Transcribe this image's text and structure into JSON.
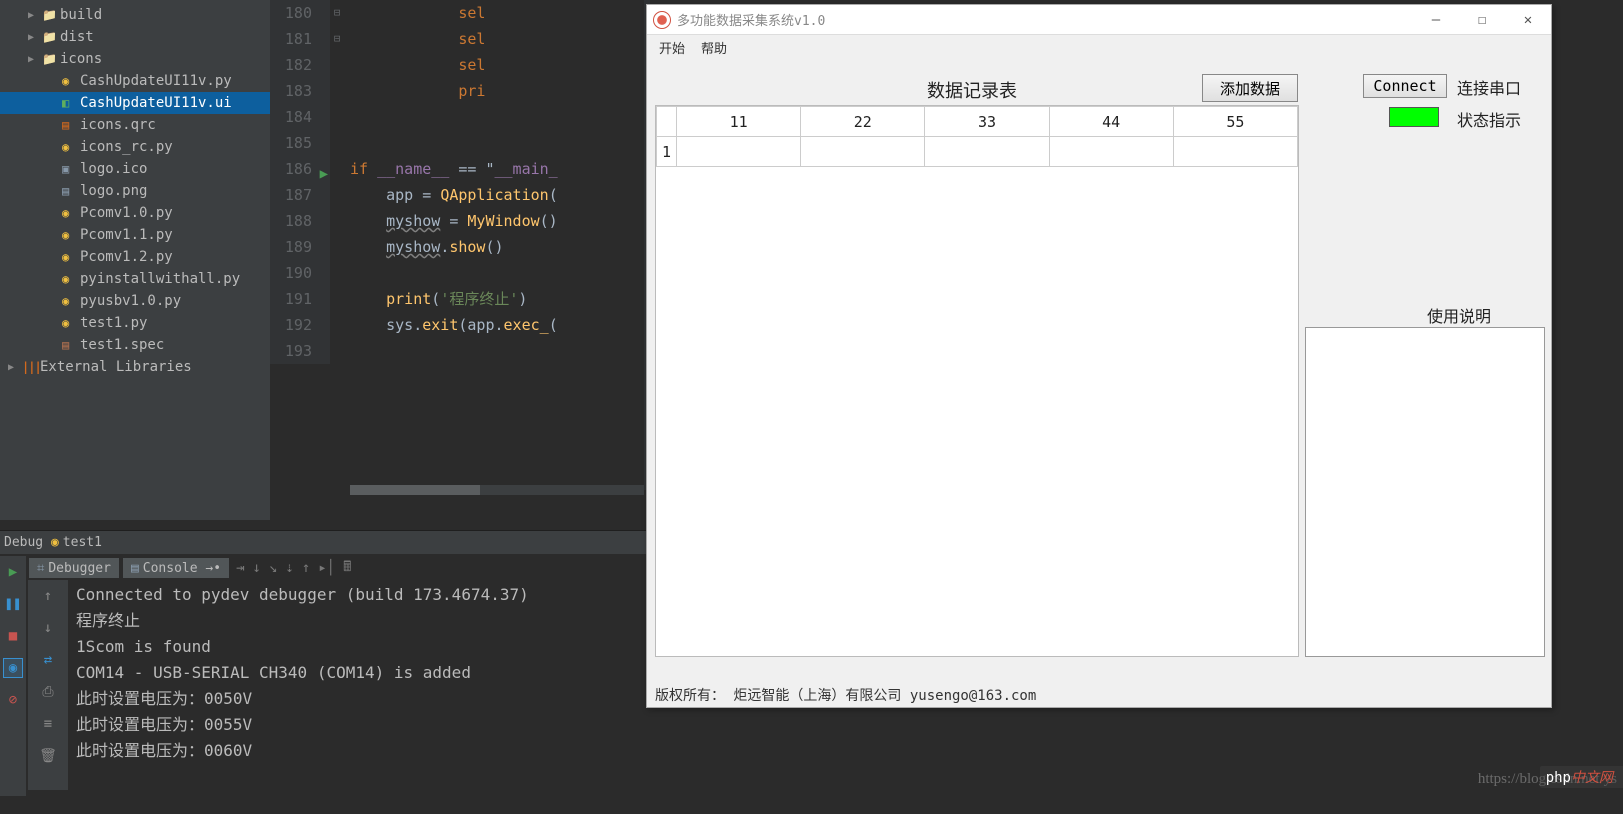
{
  "fileTree": {
    "items": [
      {
        "type": "folder",
        "name": "build",
        "indent": 1,
        "chev": "▶"
      },
      {
        "type": "folder",
        "name": "dist",
        "indent": 1,
        "chev": "▶"
      },
      {
        "type": "folder",
        "name": "icons",
        "indent": 1,
        "chev": "▶"
      },
      {
        "type": "py",
        "name": "CashUpdateUI11v.py",
        "indent": 2
      },
      {
        "type": "ui",
        "name": "CashUpdateUI11v.ui",
        "indent": 2,
        "selected": true
      },
      {
        "type": "qrc",
        "name": "icons.qrc",
        "indent": 2
      },
      {
        "type": "py",
        "name": "icons_rc.py",
        "indent": 2
      },
      {
        "type": "ico",
        "name": "logo.ico",
        "indent": 2
      },
      {
        "type": "png",
        "name": "logo.png",
        "indent": 2
      },
      {
        "type": "py",
        "name": "Pcomv1.0.py",
        "indent": 2
      },
      {
        "type": "py",
        "name": "Pcomv1.1.py",
        "indent": 2
      },
      {
        "type": "py",
        "name": "Pcomv1.2.py",
        "indent": 2
      },
      {
        "type": "py",
        "name": "pyinstallwithall.py",
        "indent": 2
      },
      {
        "type": "py",
        "name": "pyusbv1.0.py",
        "indent": 2
      },
      {
        "type": "py",
        "name": "test1.py",
        "indent": 2
      },
      {
        "type": "spec",
        "name": "test1.spec",
        "indent": 2
      },
      {
        "type": "lib",
        "name": "External Libraries",
        "indent": 0,
        "chev": "▶"
      }
    ]
  },
  "code": {
    "lineStart": 180,
    "lines": [
      "            sel",
      "            sel",
      "            sel",
      "            pri",
      "",
      "",
      "if __name__ == \"__main_",
      "    app = QApplication(",
      "    myshow = MyWindow()",
      "    myshow.show()",
      "",
      "    print('程序终止')",
      "    sys.exit(app.exec_(",
      ""
    ],
    "runLine": 186
  },
  "debug": {
    "label": "Debug",
    "runName": "test1",
    "tabs": {
      "debugger": "Debugger",
      "console": "Console"
    },
    "consoleLines": [
      "Connected to pydev debugger (build 173.4674.37)",
      "程序终止",
      "1Scom is found",
      "COM14 - USB-SERIAL CH340 (COM14) is added",
      "此时设置电压为：0050V",
      "此时设置电压为：0055V",
      "此时设置电压为：0060V"
    ]
  },
  "app": {
    "title": "多功能数据采集系统v1.0",
    "menu": {
      "start": "开始",
      "help": "帮助"
    },
    "tableTitle": "数据记录表",
    "addButton": "添加数据",
    "connectButton": "Connect",
    "connectLabel": "连接串口",
    "statusLabel": "状态指示",
    "statusColor": "#00ff00",
    "headers": [
      "11",
      "22",
      "33",
      "44",
      "55"
    ],
    "rows": [
      {
        "idx": "1",
        "cells": [
          "",
          "",
          "",
          "",
          ""
        ]
      }
    ],
    "instructionsTitle": "使用说明",
    "footer": "版权所有： 炬远智能（上海）有限公司 yusengo@163.com"
  },
  "watermark": {
    "url": "https://blog.csdn.net/ys",
    "brand": "php",
    "suffix": "中文网"
  }
}
